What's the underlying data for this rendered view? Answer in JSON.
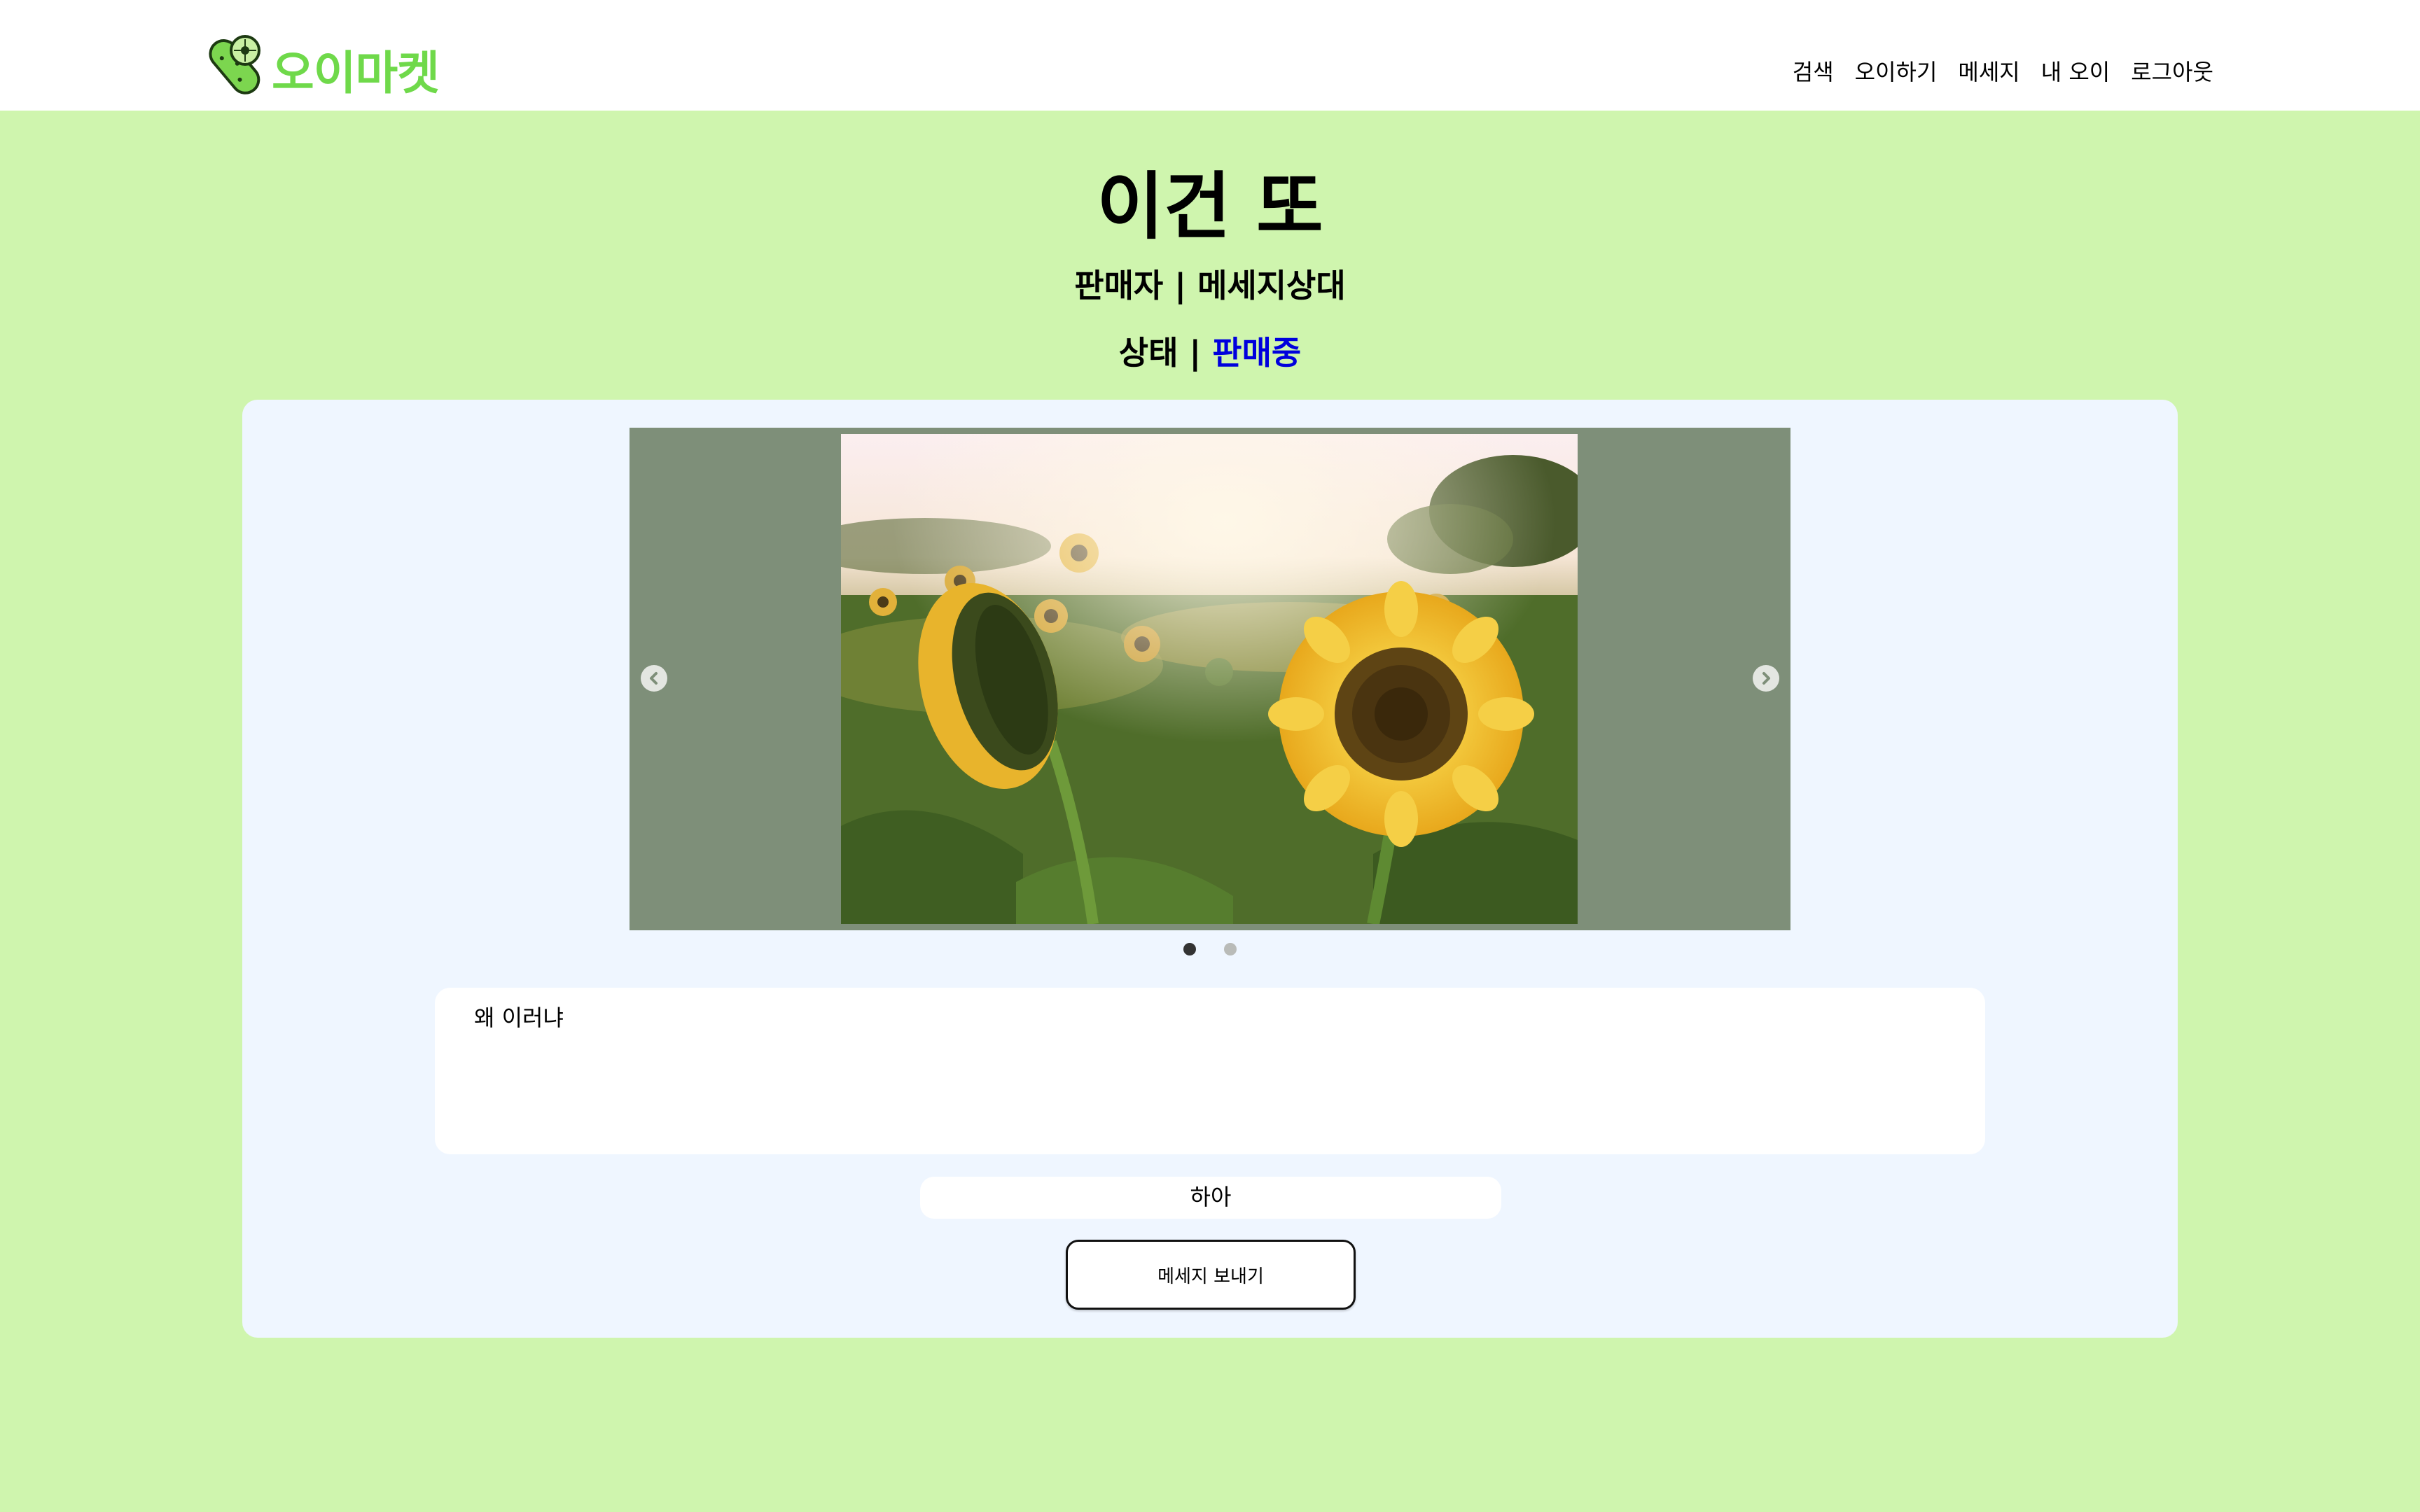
{
  "header": {
    "brand": "오이마켓",
    "nav": [
      "검색",
      "오이하기",
      "메세지",
      "내 오이",
      "로그아웃"
    ]
  },
  "item": {
    "title": "이건 또",
    "seller_label": "판매자",
    "seller_name": "메세지상대",
    "status_label": "상태",
    "status_value": "판매중",
    "separator": "|",
    "description": "왜 이러냐"
  },
  "carousel": {
    "image": "sunflower field photo",
    "slide_count": 2,
    "active_index": 0,
    "prev_icon": "chevron-left-icon",
    "next_icon": "chevron-right-icon"
  },
  "message": {
    "input_value": "하아",
    "send_label": "메세지 보내기"
  },
  "colors": {
    "page_bg": "#cff5ae",
    "brand": "#6fd94a",
    "panel_bg": "#eff6ff",
    "status": "#0000dd",
    "carousel_bg": "#7e8f79"
  }
}
